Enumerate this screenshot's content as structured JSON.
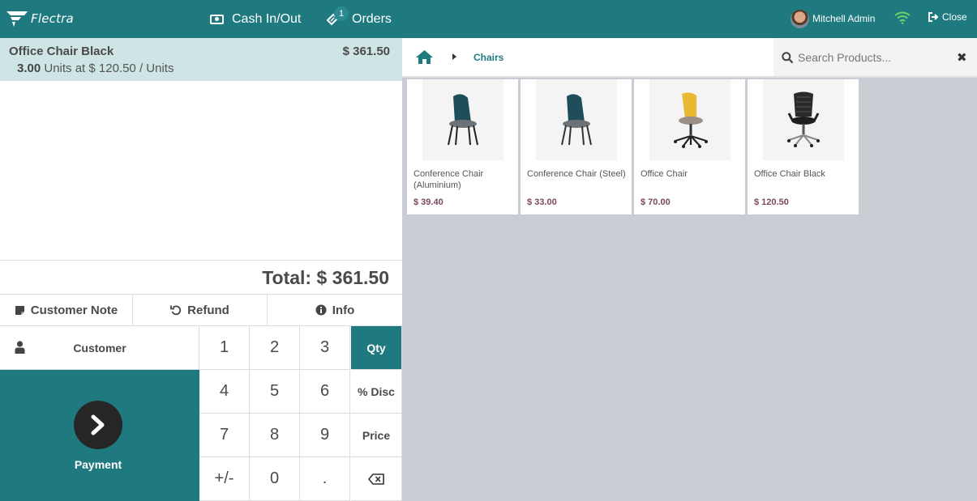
{
  "topbar": {
    "logo_text": "Flectra",
    "cash_label": "Cash In/Out",
    "orders_label": "Orders",
    "orders_badge": "1",
    "user_name": "Mitchell Admin",
    "close_label": "Close"
  },
  "order": {
    "line": {
      "name": "Office Chair Black",
      "price": "$ 361.50",
      "qty": "3.00",
      "unit_text": " Units at $ 120.50 / Units"
    },
    "total": "Total: $ 361.50"
  },
  "controls": {
    "customer_note": "Customer Note",
    "refund": "Refund",
    "info": "Info"
  },
  "customer_label": "Customer",
  "payment_label": "Payment",
  "numpad": {
    "keys": [
      "1",
      "2",
      "3",
      "Qty",
      "4",
      "5",
      "6",
      "% Disc",
      "7",
      "8",
      "9",
      "Price",
      "+/-",
      "0",
      ".",
      "⌫"
    ],
    "active_mode": "Qty"
  },
  "breadcrumb": {
    "category": "Chairs"
  },
  "search": {
    "placeholder": "Search Products..."
  },
  "products": [
    {
      "name": "Conference Chair (Aluminium)",
      "price": "$ 39.40",
      "image": "teal-chair"
    },
    {
      "name": "Conference Chair (Steel)",
      "price": "$ 33.00",
      "image": "teal-chair"
    },
    {
      "name": "Office Chair",
      "price": "$ 70.00",
      "image": "yellow-swivel-chair"
    },
    {
      "name": "Office Chair Black",
      "price": "$ 120.50",
      "image": "black-mesh-chair"
    }
  ],
  "colors": {
    "brand": "#1f7a80",
    "selected_line": "#cfe4e5",
    "product_area": "#c9ccd2",
    "price": "#7b4660"
  }
}
